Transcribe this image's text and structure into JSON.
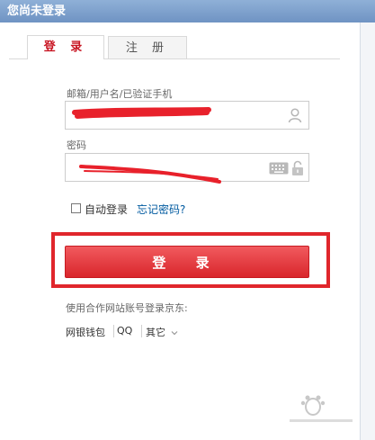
{
  "window": {
    "title": "您尚未登录"
  },
  "tabs": [
    {
      "label": "登 录",
      "active": true
    },
    {
      "label": "注 册",
      "active": false
    }
  ],
  "form": {
    "username_label": "邮箱/用户名/已验证手机",
    "username_value": "",
    "password_label": "密码",
    "password_value": "",
    "auto_login_label": "自动登录",
    "forgot_password_link": "忘记密码?",
    "submit_label": "登 录"
  },
  "partners": {
    "title": "使用合作网站账号登录京东:",
    "items": [
      "网银钱包",
      "QQ",
      "其它"
    ]
  },
  "icons": {
    "user": "user-icon",
    "keyboard": "keyboard-icon",
    "lock": "lock-icon",
    "dropdown": "chevron-down-icon"
  },
  "colors": {
    "accent": "#c81623",
    "button": "#e4393c",
    "link": "#005aa0",
    "annotation": "#e0262c"
  }
}
